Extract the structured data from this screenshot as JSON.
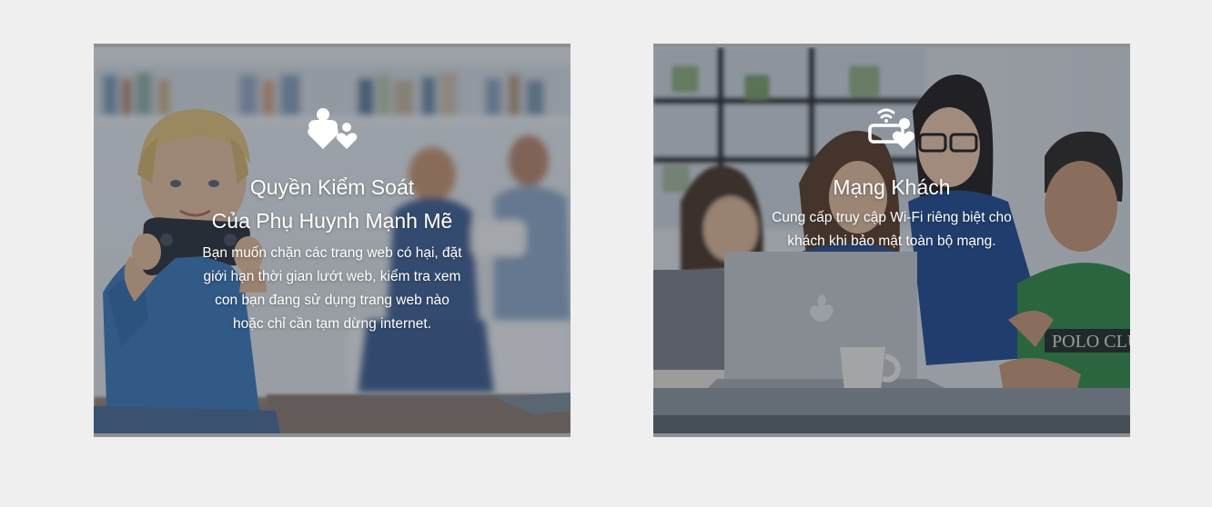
{
  "colors": {
    "page_background": "#efefef",
    "card_border": "#8d9093",
    "text": "#ffffff"
  },
  "cards": [
    {
      "icon": "family-hearts-icon",
      "title_line1": "Quyền Kiểm Soát",
      "title_line2": "Của Phụ Huynh Mạnh Mẽ",
      "desc_lines": [
        "Bạn muốn chặn các trang web có hại, đặt",
        "giới hạn thời gian lướt web, kiểm tra xem",
        "con bạn đang sử dụng trang web nào",
        "hoặc chỉ cần tạm dừng internet."
      ]
    },
    {
      "icon": "guest-wifi-icon",
      "title": "Mạng Khách",
      "desc_lines": [
        "Cung cấp truy cập Wi-Fi riêng biệt cho",
        "khách khi bảo mật toàn bộ mạng."
      ]
    }
  ]
}
